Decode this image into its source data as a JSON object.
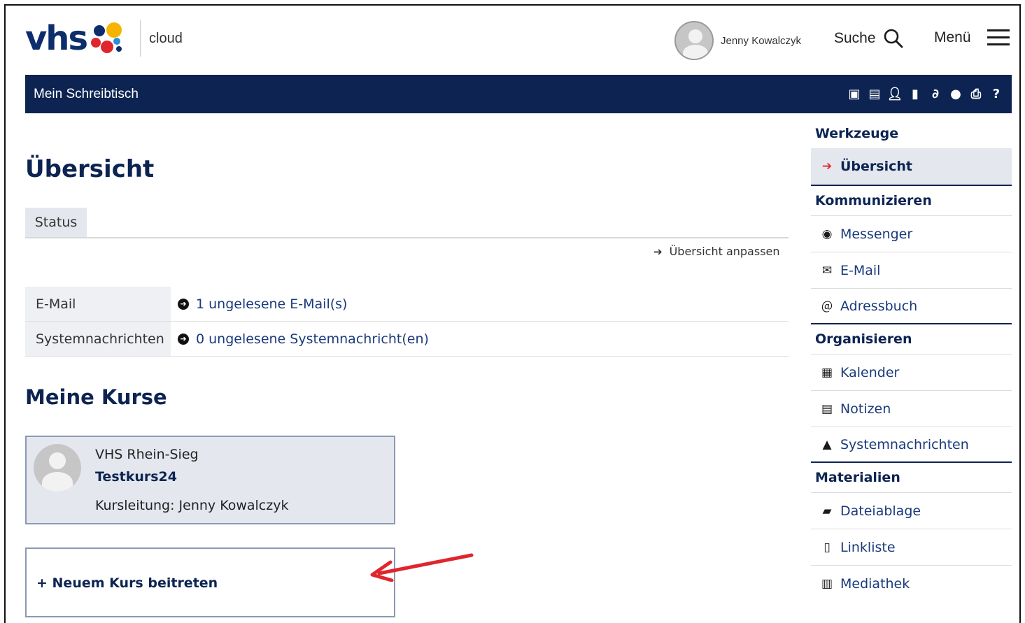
{
  "header": {
    "logo_text": "vhs",
    "logo_sub": "cloud",
    "user_name": "Jenny Kowalczyk",
    "search_label": "Suche",
    "menu_label": "Menü"
  },
  "navbar": {
    "title": "Mein Schreibtisch",
    "icons": [
      "tour-icon",
      "notes-icon",
      "user-icon",
      "bookmark-icon",
      "link-icon",
      "help-bubble-icon",
      "print-icon",
      "help-icon"
    ]
  },
  "main": {
    "page_title": "Übersicht",
    "status_tab": "Status",
    "customize_link": "Übersicht anpassen",
    "info_rows": [
      {
        "label": "E-Mail",
        "value": "1 ungelesene E-Mail(s)"
      },
      {
        "label": "Systemnachrichten",
        "value": "0 ungelesene Systemnachricht(en)"
      }
    ],
    "courses_title": "Meine Kurse",
    "course": {
      "org": "VHS Rhein-Sieg",
      "name": "Testkurs24",
      "lead": "Kursleitung: Jenny Kowalczyk"
    },
    "join_label": "+ Neuem Kurs beitreten"
  },
  "sidebar": {
    "tools_head": "Werkzeuge",
    "overview": "Übersicht",
    "comm_head": "Kommunizieren",
    "messenger": "Messenger",
    "email": "E-Mail",
    "addressbook": "Adressbuch",
    "org_head": "Organisieren",
    "calendar": "Kalender",
    "notes": "Notizen",
    "sysmsg": "Systemnachrichten",
    "mat_head": "Materialien",
    "files": "Dateiablage",
    "links": "Linkliste",
    "media": "Mediathek"
  },
  "colors": {
    "navy": "#0d2452",
    "accent_red": "#e0262d",
    "panel": "#e4e8ee"
  }
}
